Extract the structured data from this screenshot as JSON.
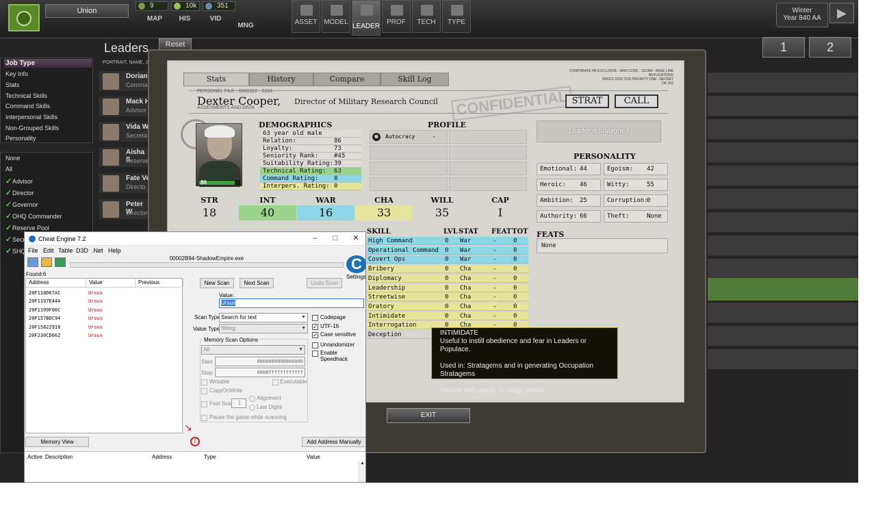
{
  "topbar": {
    "nation": "Union",
    "resources": [
      "9",
      "10k",
      "351"
    ],
    "small_nav": [
      "MAP",
      "HIS",
      "VID",
      "MNG"
    ],
    "big_nav": [
      "ASSET",
      "MODEL",
      "LEADER",
      "PROF",
      "TECH",
      "TYPE"
    ],
    "season": "Winter",
    "year": "Year 840 AA"
  },
  "sidebar": {
    "job_type": "Job Type",
    "items": [
      "Key Info",
      "Stats",
      "Technical Skills",
      "Command Skills",
      "Interpersonal Skills",
      "Non-Grouped Skills",
      "Personality"
    ],
    "filters": [
      "None",
      "All"
    ],
    "jobs": [
      "Advisor",
      "Director",
      "Governor",
      "OHQ Commander",
      "Reserve Pool",
      "Secr",
      "SHQ"
    ]
  },
  "leaders": {
    "title": "Leaders",
    "reset": "Reset",
    "header": "PORTRAIT, NAME, JO",
    "rows": [
      {
        "name": "Dorian",
        "sub": "Comma"
      },
      {
        "name": "Mack H",
        "sub": "Advisor"
      },
      {
        "name": "Vida W",
        "sub": "Secreta"
      },
      {
        "name": "Aisha S",
        "sub": "Reserve"
      },
      {
        "name": "Fate Ve",
        "sub": "Directo"
      },
      {
        "name": "Peter W",
        "sub": "Director"
      }
    ]
  },
  "pages": [
    "1",
    "2"
  ],
  "panel": {
    "tabs": [
      "Stats",
      "History",
      "Compare",
      "Skill Log"
    ],
    "corp": "CORPORATE HR EXCLUSIVE - 0040 CODE - 331384 - BASE LINE REPLICATIONS\n000922-3333-7225 PRIORITY ONE - SECRET\nOK 202",
    "personnel_file": "PERSONEL FILE - 0002322 - 3333",
    "leader_name": "Dexter Cooper,",
    "leader_title": "Director of Military Research Council",
    "assessments": "ASSESMENTS AND DATA",
    "confidential": "CONFIDENTIAL",
    "strat": "STRAT",
    "call": "CALL",
    "portrait_value": "86",
    "demographics_title": "DEMOGRAPHICS",
    "demographics": [
      {
        "label": "63 year old male",
        "value": ""
      },
      {
        "label": "Relation:",
        "value": "86"
      },
      {
        "label": "Loyalty:",
        "value": "73"
      },
      {
        "label": "Seniority Rank:",
        "value": "#45"
      },
      {
        "label": "Suitability Rating:",
        "value": "39"
      },
      {
        "label": "Technical Rating:",
        "value": "63"
      },
      {
        "label": "Command Rating:",
        "value": "0"
      },
      {
        "label": "Interpers. Rating:",
        "value": "0"
      }
    ],
    "profile_title": "PROFILE",
    "profile_item": "Autocracy",
    "profile_value": "-",
    "stats": [
      {
        "name": "STR",
        "value": "18",
        "color": "#d7d5cf"
      },
      {
        "name": "INT",
        "value": "40",
        "color": "#9ad48a"
      },
      {
        "name": "WAR",
        "value": "16",
        "color": "#8cd6e6"
      },
      {
        "name": "CHA",
        "value": "33",
        "color": "#e4e49a"
      },
      {
        "name": "WILL",
        "value": "35",
        "color": "#d7d5cf"
      },
      {
        "name": "CAP",
        "value": "I",
        "color": "#d7d5cf"
      }
    ],
    "alignment": "Leader is unaligned",
    "personality_title": "PERSONALITY",
    "personality": [
      {
        "label": "Emotional:",
        "value": "44"
      },
      {
        "label": "Egoism:",
        "value": "42"
      },
      {
        "label": "Heroic:",
        "value": "46"
      },
      {
        "label": "Witty:",
        "value": "55"
      },
      {
        "label": "Ambition:",
        "value": "25"
      },
      {
        "label": "Corruption:",
        "value": "0"
      },
      {
        "label": "Authority:",
        "value": "66"
      },
      {
        "label": "Theft:",
        "value": "None"
      }
    ],
    "feats_title": "FEATS",
    "feats": "None",
    "skills_header": [
      "SKILL",
      "LVL",
      "STAT",
      "FEAT",
      "TOT"
    ],
    "skills": [
      {
        "skill": "High Command",
        "lvl": "0",
        "stat": "War",
        "feat": "-",
        "tot": "0",
        "color": "#8cd6e6"
      },
      {
        "skill": "Operational Command",
        "lvl": "0",
        "stat": "War",
        "feat": "-",
        "tot": "0",
        "color": "#8cd6e6"
      },
      {
        "skill": "Covert Ops",
        "lvl": "0",
        "stat": "War",
        "feat": "-",
        "tot": "0",
        "color": "#8cd6e6"
      },
      {
        "skill": "Bribery",
        "lvl": "0",
        "stat": "Cha",
        "feat": "-",
        "tot": "0",
        "color": "#e4e49a"
      },
      {
        "skill": "Diplomacy",
        "lvl": "0",
        "stat": "Cha",
        "feat": "-",
        "tot": "0",
        "color": "#e4e49a"
      },
      {
        "skill": "Leadership",
        "lvl": "0",
        "stat": "Cha",
        "feat": "-",
        "tot": "0",
        "color": "#e4e49a"
      },
      {
        "skill": "Streetwise",
        "lvl": "0",
        "stat": "Cha",
        "feat": "-",
        "tot": "0",
        "color": "#e4e49a"
      },
      {
        "skill": "Oratory",
        "lvl": "0",
        "stat": "Cha",
        "feat": "-",
        "tot": "0",
        "color": "#e4e49a"
      },
      {
        "skill": "Intimidate",
        "lvl": "0",
        "stat": "Cha",
        "feat": "-",
        "tot": "0",
        "color": "#e4e49a"
      },
      {
        "skill": "Interrogation",
        "lvl": "0",
        "stat": "Cha",
        "feat": "-",
        "tot": "0",
        "color": "#e4e49a"
      },
      {
        "skill": "Deception",
        "lvl": "",
        "stat": "",
        "feat": "",
        "tot": "",
        "color": "#d7d5cf"
      }
    ],
    "tooltip": {
      "title": "INTIMIDATE",
      "line1": "Useful to instill obedience and fear in Leaders or Populace.",
      "line2": "Used in: Stratagems and in generating Occupation Stratagems",
      "line3": "Recent skill usage: 0 usage points."
    },
    "exit": "EXIT"
  },
  "ce": {
    "title": "Cheat Engine 7.2",
    "menu": [
      "File",
      "Edit",
      "Table",
      "D3D",
      ".Net",
      "Help"
    ],
    "process": "00002B94-ShadowEmpire.exe",
    "found": "Found:6",
    "columns": [
      "Address",
      "Value",
      "Previous"
    ],
    "results": [
      {
        "address": "20F118D67AC",
        "value": "Ursus"
      },
      {
        "address": "20F1197E444",
        "value": "Ursus"
      },
      {
        "address": "20F1199F00C",
        "value": "Ursus"
      },
      {
        "address": "20F157BDC94",
        "value": "Ursus"
      },
      {
        "address": "20F15822918",
        "value": "Ursus"
      },
      {
        "address": "20F230CD662",
        "value": "Ursus"
      }
    ],
    "new_scan": "New Scan",
    "next_scan": "Next Scan",
    "undo_scan": "Undo Scan",
    "settings": "Settings",
    "value_label": "Value:",
    "value": "Ursus",
    "scan_type_label": "Scan Type",
    "scan_type": "Search for text",
    "value_type_label": "Value Type",
    "value_type": "String",
    "mem_opts": "Memory Scan Options",
    "mem_all": "All",
    "start_label": "Start",
    "start": "0000000000000000",
    "stop_label": "Stop",
    "stop": "00007fffffffffff",
    "writable": "Writable",
    "executable": "Executable",
    "copyonwrite": "CopyOnWrite",
    "fast_scan": "Fast Scan",
    "fast_val": "1",
    "alignment": "Alignment",
    "last_digits": "Last Digits",
    "pause": "Pause the game while scanning",
    "codepage": "Codepage",
    "utf16": "UTF-16",
    "case_sensitive": "Case sensitive",
    "unrandomizer": "Unrandomizer",
    "speedhack": "Enable Speedhack",
    "memory_view": "Memory View",
    "add_manual": "Add Address Manually",
    "table_cols": [
      "Active",
      "Description",
      "Address",
      "Type",
      "Value"
    ]
  }
}
